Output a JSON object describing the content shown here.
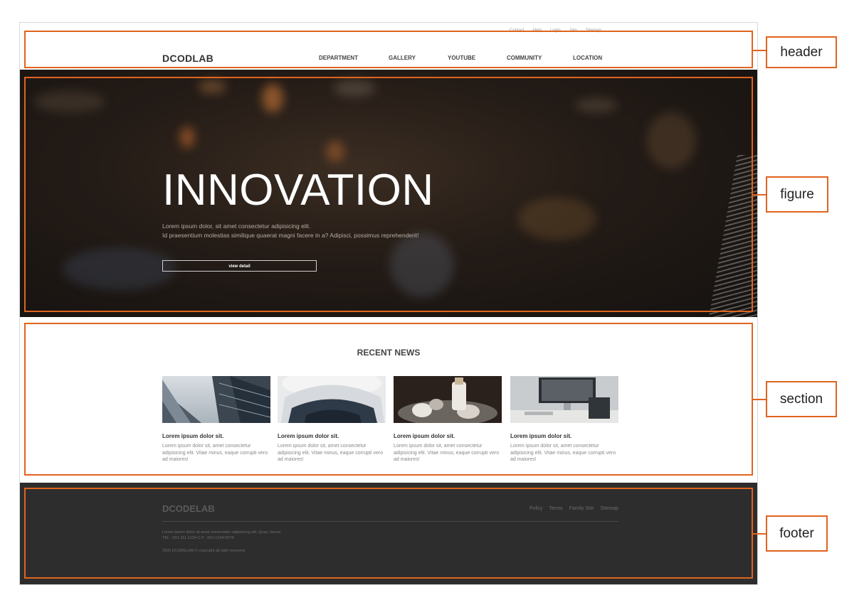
{
  "header": {
    "logo": "DCODLAB",
    "util_links": [
      "Contact",
      "Help",
      "Login",
      "Join",
      "Sitemap"
    ],
    "nav": [
      "DEPARTMENT",
      "GALLERY",
      "YOUTUBE",
      "COMMUNITY",
      "LOCATION"
    ]
  },
  "hero": {
    "title": "INNOVATION",
    "desc_line1": "Lorem ipsum dolor, sit amet consectetur adipisicing elit.",
    "desc_line2": "Id praesentium molestias similique quaerat magni facere in a? Adipisci, possimus reprehenderit!",
    "button": "view detail"
  },
  "news": {
    "title": "RECENT NEWS",
    "cards": [
      {
        "heading": "Lorem ipsum dolor sit.",
        "text": "Lorem ipsum dolor sit, amet consectetur adipisicing elit. Vitae minus, eaque corrupti vero ad maiores!"
      },
      {
        "heading": "Lorem ipsum dolor sit.",
        "text": "Lorem ipsum dolor sit, amet consectetur adipisicing elit. Vitae minus, eaque corrupti vero ad maiores!"
      },
      {
        "heading": "Lorem ipsum dolor sit.",
        "text": "Lorem ipsum dolor sit, amet consectetur adipisicing elit. Vitae minus, eaque corrupti vero ad maiores!"
      },
      {
        "heading": "Lorem ipsum dolor sit.",
        "text": "Lorem ipsum dolor sit, amet consectetur adipisicing elit. Vitae minus, eaque corrupti vero ad maiores!"
      }
    ]
  },
  "footer": {
    "logo": "DCODELAB",
    "links": [
      "Policy",
      "Terms",
      "Family Site",
      "Sitemap"
    ],
    "info_line1": "Lorem ipsum dolor sit amet consectetur adipisicing elit. Quas, facere.",
    "info_line2": "TEL : 031-111-1234 C.P : 010-1234-5678",
    "copyright": "2020 DCODELAB © copyright all right reserved."
  },
  "annotations": {
    "labels": [
      "header",
      "figure",
      "section",
      "footer"
    ],
    "color": "#e0641e"
  }
}
